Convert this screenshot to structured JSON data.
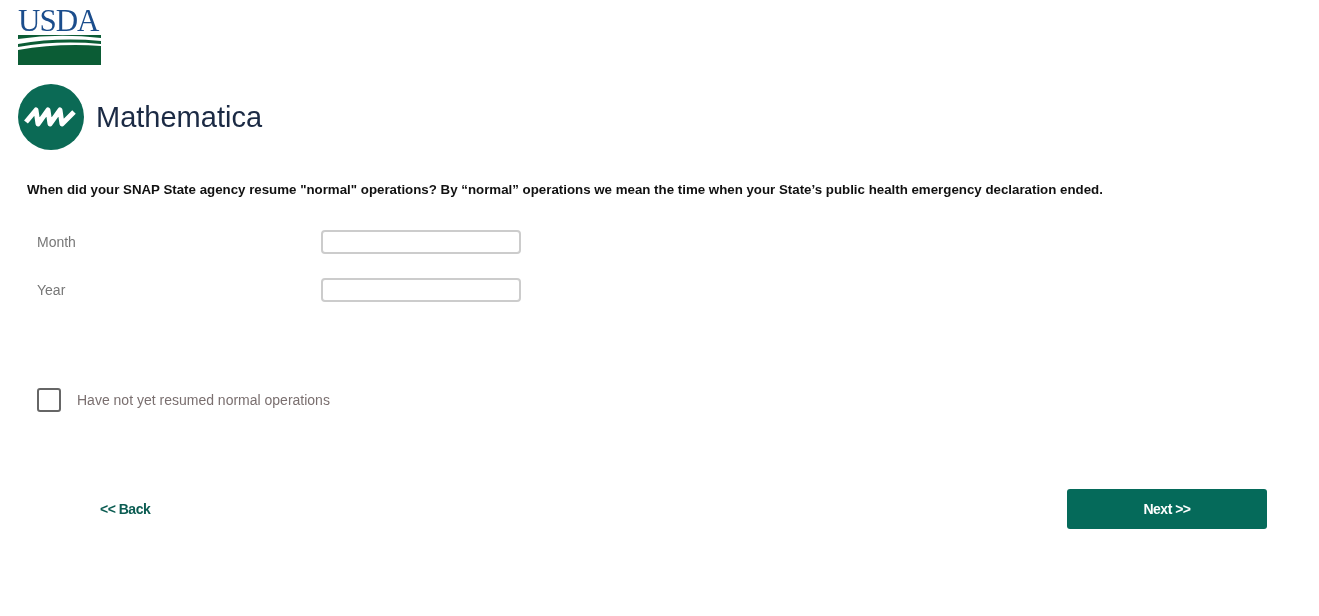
{
  "logos": {
    "usda": "USDA",
    "mathematica": "Mathematica"
  },
  "question": "When did your SNAP State agency resume \"normal\" operations? By “normal” operations we mean the time when your State’s public health emergency declaration ended.",
  "fields": [
    {
      "label": "Month"
    },
    {
      "label": "Year"
    }
  ],
  "option": {
    "label": "Have not yet resumed normal operations",
    "checked": false
  },
  "buttons": {
    "back": "<< Back",
    "next": "Next >>"
  }
}
